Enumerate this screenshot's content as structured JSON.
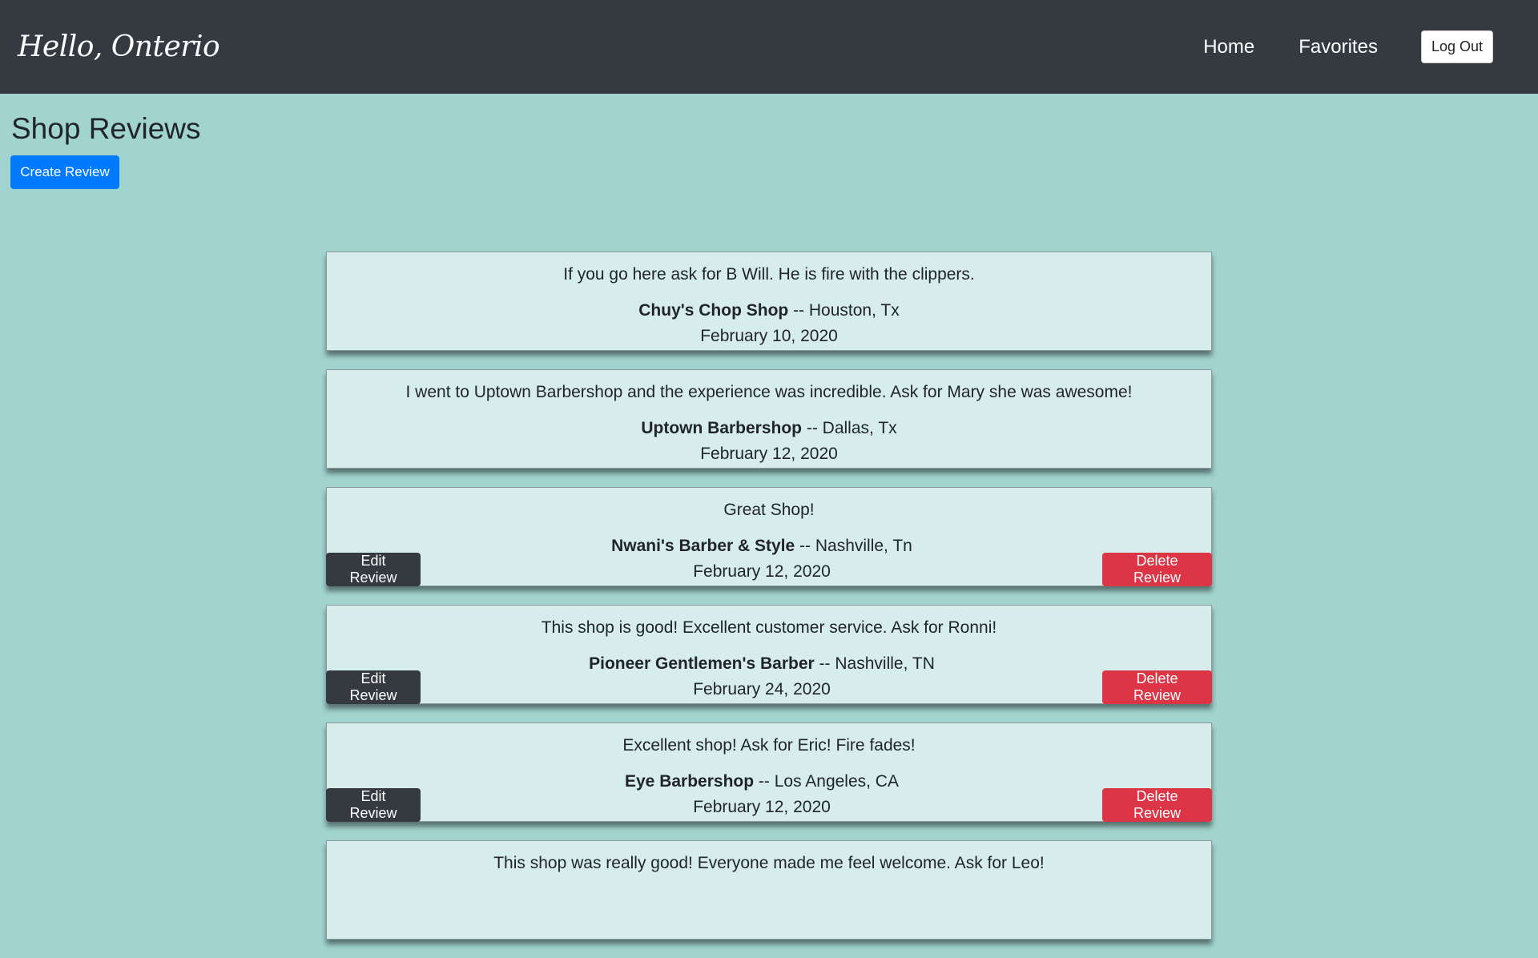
{
  "navbar": {
    "brand": "Hello, Onterio",
    "links": [
      "Home",
      "Favorites"
    ],
    "logout_label": "Log Out"
  },
  "page": {
    "title": "Shop Reviews",
    "create_label": "Create Review"
  },
  "buttons": {
    "edit_label": "Edit Review",
    "delete_label": "Delete Review"
  },
  "reviews": [
    {
      "text": "If you go here ask for B Will. He is fire with the clippers.",
      "shop": "Chuy's Chop Shop",
      "location": " -- Houston, Tx",
      "date": "February 10, 2020",
      "owned": false
    },
    {
      "text": "I went to Uptown Barbershop and the experience was incredible. Ask for Mary she was awesome!",
      "shop": "Uptown Barbershop",
      "location": " -- Dallas, Tx",
      "date": "February 12, 2020",
      "owned": false
    },
    {
      "text": "Great Shop!",
      "shop": "Nwani's Barber & Style",
      "location": " -- Nashville, Tn",
      "date": "February 12, 2020",
      "owned": true
    },
    {
      "text": "This shop is good! Excellent customer service. Ask for Ronni!",
      "shop": "Pioneer Gentlemen's Barber",
      "location": " -- Nashville, TN",
      "date": "February 24, 2020",
      "owned": true
    },
    {
      "text": "Excellent shop! Ask for Eric! Fire fades!",
      "shop": "Eye Barbershop",
      "location": " -- Los Angeles, CA",
      "date": "February 12, 2020",
      "owned": true
    },
    {
      "text": "This shop was really good! Everyone made me feel welcome. Ask for Leo!",
      "shop": "",
      "location": "",
      "date": "",
      "owned": false
    }
  ]
}
